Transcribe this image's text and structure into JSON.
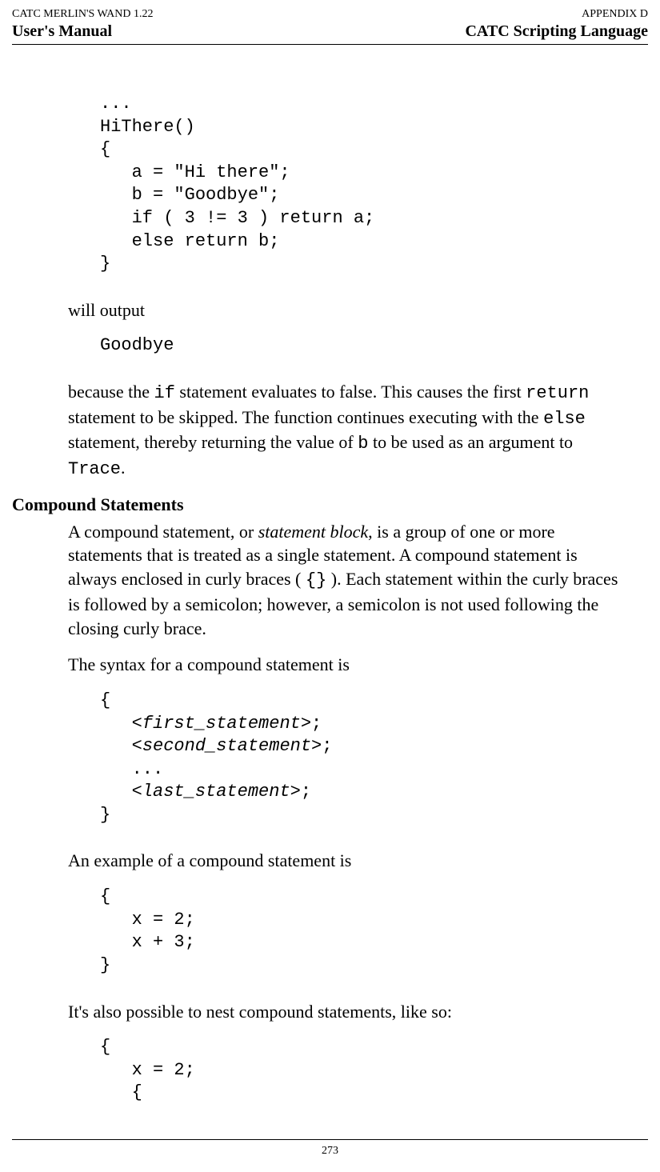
{
  "header": {
    "topLeft": "CATC MERLIN'S WAND 1.22",
    "topRight": "APPENDIX D",
    "bottomLeft": "User's Manual",
    "bottomRight": "CATC Scripting Language"
  },
  "codeBlock1": "...\nHiThere()\n{\n   a = \"Hi there\";\n   b = \"Goodbye\";\n   if ( 3 != 3 ) return a;\n   else return b;\n}",
  "willOutput": "will output",
  "codeBlock2": "Goodbye",
  "paragraph1": {
    "pre1": "because the ",
    "mono1": "if",
    "mid1": " statement evaluates to false. This causes the first ",
    "mono2": "return",
    "mid2": " statement to be skipped. The function continues executing with the ",
    "mono3": "else",
    "mid3": " statement, thereby returning the value of ",
    "mono4": "b",
    "mid4": " to be used as an argument to ",
    "mono5": "Trace",
    "end": "."
  },
  "sectionHeading": "Compound Statements",
  "paragraph2": {
    "pre": "A compound statement, or ",
    "italic": "statement block",
    "mid": ", is a group of one or more statements that is treated as a single statement. A compound statement is always enclosed in curly braces ( ",
    "mono": "{}",
    "end": " ). Each statement within the curly braces is followed by a semicolon; however, a semicolon is not used following the closing curly brace."
  },
  "paragraph3": "The syntax for a compound statement is",
  "codeBlock3": {
    "open": "{",
    "line1a": "   <",
    "line1b": "first_statement",
    "line1c": ">;",
    "line2a": "   <",
    "line2b": "second_statement",
    "line2c": ">;",
    "line3": "   ...",
    "line4a": "   <",
    "line4b": "last_statement",
    "line4c": ">;",
    "close": "}"
  },
  "paragraph4": "An example of a compound statement is",
  "codeBlock4": "{\n   x = 2;\n   x + 3;\n}",
  "paragraph5": "It's also possible to nest compound statements, like so:",
  "codeBlock5": "{\n   x = 2;\n   {",
  "pageNumber": "273"
}
